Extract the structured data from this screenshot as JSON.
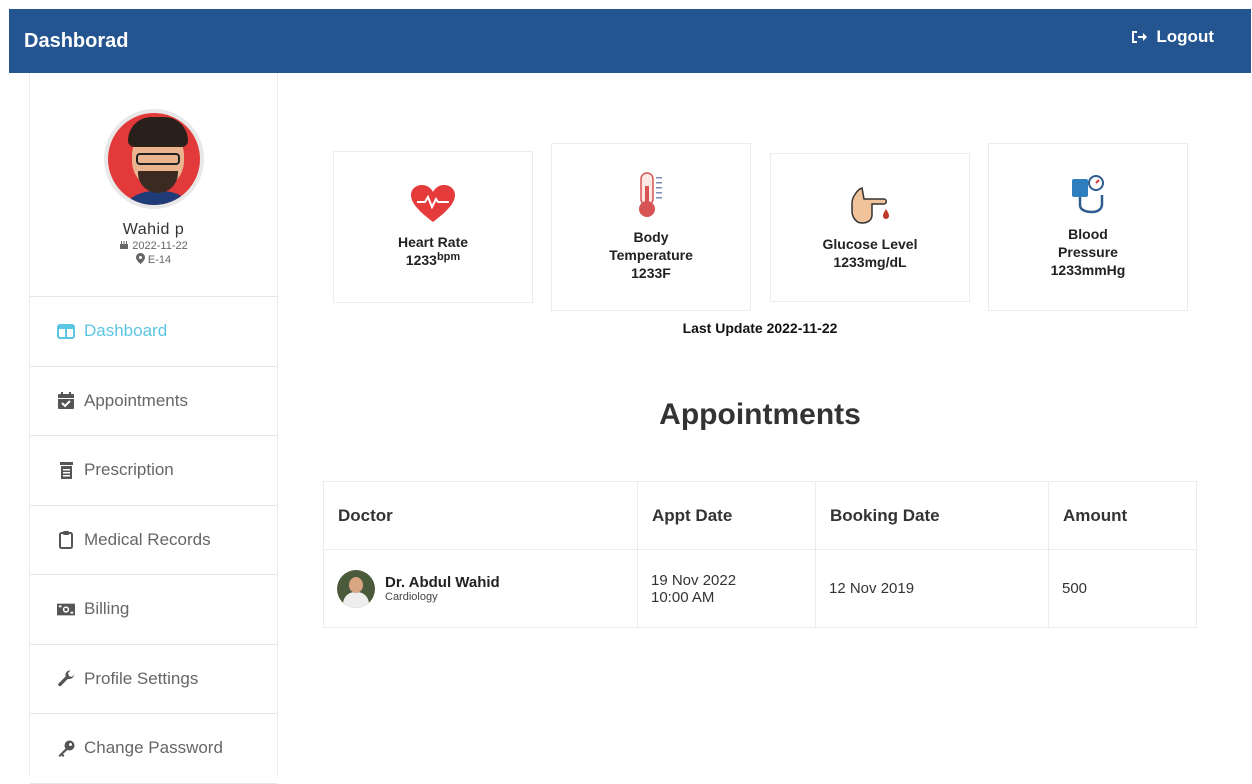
{
  "topbar": {
    "title": "Dashborad",
    "logout_label": "Logout"
  },
  "profile": {
    "name": "Wahid p",
    "dob": "2022-11-22",
    "location": "E-14"
  },
  "sidebar": {
    "items": [
      {
        "label": "Dashboard",
        "icon": "columns-icon"
      },
      {
        "label": "Appointments",
        "icon": "calendar-check-icon"
      },
      {
        "label": "Prescription",
        "icon": "file-prescription-icon"
      },
      {
        "label": "Medical Records",
        "icon": "clipboard-icon"
      },
      {
        "label": "Billing",
        "icon": "money-bill-icon"
      },
      {
        "label": "Profile Settings",
        "icon": "wrench-icon"
      },
      {
        "label": "Change Password",
        "icon": "key-icon"
      }
    ]
  },
  "vitals": {
    "heart_rate": {
      "label": "Heart Rate",
      "value": "1233",
      "unit": "bpm"
    },
    "body_temp": {
      "label_line1": "Body",
      "label_line2": "Temperature",
      "value": "1233F"
    },
    "glucose": {
      "label": "Glucose Level",
      "value": "1233mg/dL"
    },
    "blood_pressure": {
      "label_line1": "Blood",
      "label_line2": "Pressure",
      "value": "1233mmHg"
    },
    "last_update": "Last Update 2022-11-22"
  },
  "appointments": {
    "title": "Appointments",
    "columns": [
      "Doctor",
      "Appt Date",
      "Booking Date",
      "Amount"
    ],
    "rows": [
      {
        "doctor": "Dr. Abdul Wahid",
        "specialty": "Cardiology",
        "appt_date": "19 Nov 2022",
        "appt_time": "10:00 AM",
        "booking_date": "12 Nov 2019",
        "amount": "500"
      }
    ]
  },
  "colors": {
    "topbar": "#245590",
    "active_menu": "#5bc5e4",
    "heart": "#e63b3b"
  }
}
